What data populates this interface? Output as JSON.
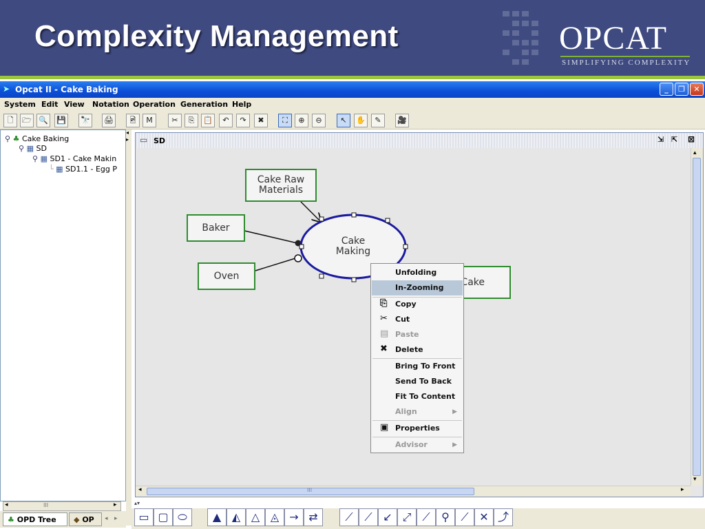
{
  "slide": {
    "title": "Complexity Management",
    "logo_text": "OPCAT",
    "logo_tagline": "SIMPLIFYING COMPLEXITY"
  },
  "window": {
    "title": "Opcat II - Cake Baking",
    "buttons": {
      "minimize": "_",
      "maximize": "❐",
      "close": "✕"
    }
  },
  "menu": {
    "items": [
      "System",
      "Edit",
      "View",
      "Notation",
      "Operation",
      "Generation",
      "Help"
    ]
  },
  "toolbar": {
    "icons": [
      "new-icon",
      "open-icon",
      "search-icon",
      "save-icon",
      "binoculars-icon",
      "print-icon",
      "image-icon",
      "map-icon",
      "cut-icon",
      "copy-icon",
      "paste-icon",
      "undo-icon",
      "redo-icon",
      "delete-icon",
      "fit-icon",
      "zoom-in-icon",
      "zoom-out-icon",
      "pointer-icon",
      "hand-icon",
      "pencil-icon",
      "camera-icon"
    ],
    "glyphs": [
      "🗋",
      "🗁",
      "🔍",
      "💾",
      "🔭",
      "🖨",
      "🖻",
      "M",
      "✂",
      "⎘",
      "📋",
      "↶",
      "↷",
      "✖",
      "⛶",
      "⊕",
      "⊖",
      "↖",
      "✋",
      "✎",
      "🎥"
    ]
  },
  "tree": {
    "root": "Cake Baking",
    "sd": "SD",
    "sd1": "SD1 - Cake Makin",
    "sd11": "SD1.1 - Egg P"
  },
  "bottom_tabs": {
    "opd_tree": "OPD Tree",
    "opd2": "OP"
  },
  "left_scroll": {
    "mark": "III"
  },
  "diagram_window": {
    "title": "SD",
    "scroll_mark": "III"
  },
  "diagram": {
    "objects": {
      "raw_materials": "Cake Raw\nMaterials",
      "baker": "Baker",
      "oven": "Oven",
      "cake": "Cake"
    },
    "process": {
      "line1": "Cake",
      "line2": "Making"
    }
  },
  "context_menu": {
    "unfolding": "Unfolding",
    "in_zooming": "In-Zooming",
    "copy": "Copy",
    "cut": "Cut",
    "paste": "Paste",
    "delete": "Delete",
    "bring_to_front": "Bring To Front",
    "send_to_back": "Send To Back",
    "fit_to_content": "Fit To Content",
    "align": "Align",
    "properties": "Properties",
    "advisor": "Advisor"
  },
  "colors": {
    "header_bg": "#3f4a80",
    "accent_green": "#9bc53d",
    "object_border": "#2e8b2e",
    "process_border": "#1a1aa0",
    "menu_highlight": "#b8c8d8"
  }
}
